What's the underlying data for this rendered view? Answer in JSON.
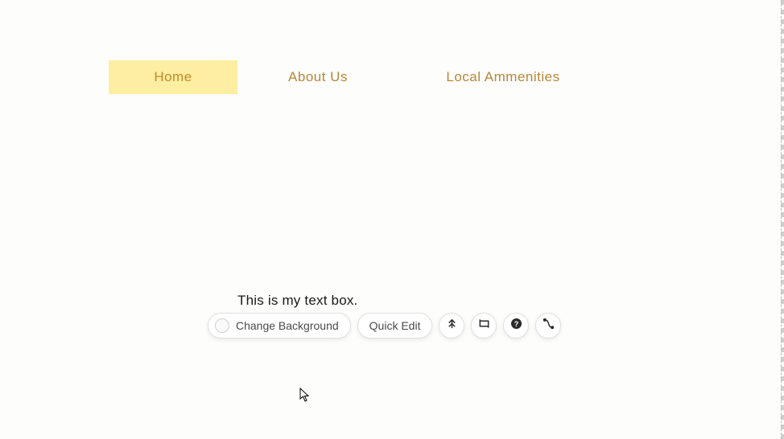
{
  "nav": {
    "home": "Home",
    "about": "About Us",
    "local": "Local Ammenities"
  },
  "textbox": {
    "content": "This is my text box."
  },
  "toolbar": {
    "change_bg_label": "Change Background",
    "quick_edit_label": "Quick Edit"
  }
}
